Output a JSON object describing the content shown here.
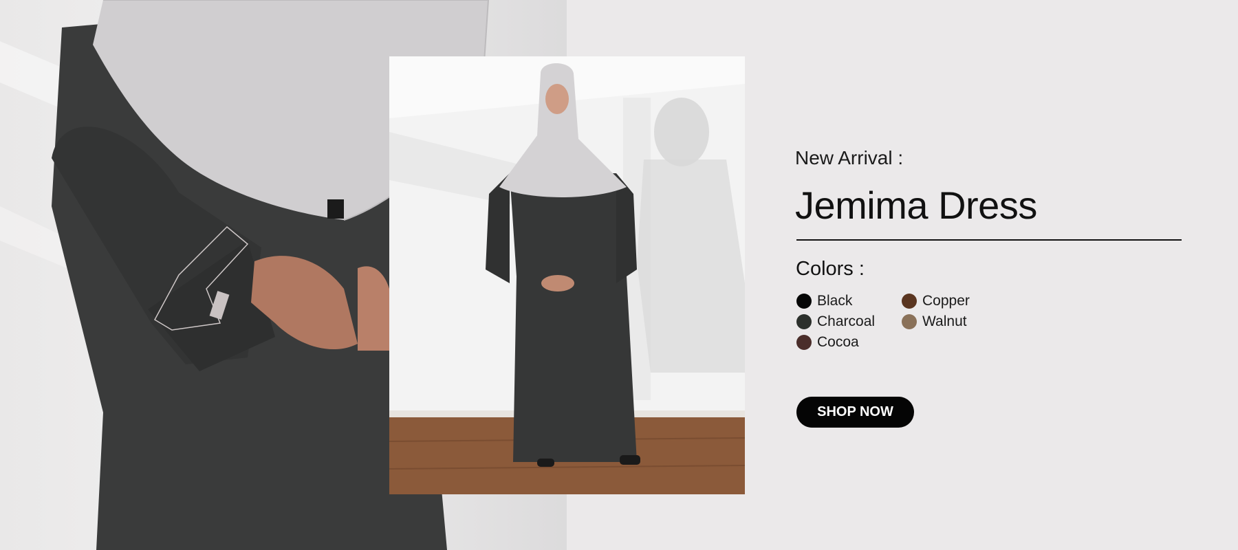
{
  "banner": {
    "subtitle": "New Arrival :",
    "title": "Jemima Dress",
    "colors_heading": "Colors :",
    "colors": [
      {
        "name": "Black",
        "hex": "#060606"
      },
      {
        "name": "Copper",
        "hex": "#5a3520"
      },
      {
        "name": "Charcoal",
        "hex": "#2c302c"
      },
      {
        "name": "Walnut",
        "hex": "#8a7159"
      },
      {
        "name": "Cocoa",
        "hex": "#4a2d2a"
      }
    ],
    "cta_label": "SHOP NOW"
  },
  "images": {
    "closeup_alt": "close-up-photo",
    "full_alt": "full-length-photo"
  },
  "palette": {
    "background": "#ebe9ea",
    "garment": "#3b3c3c",
    "hijab": "#d3d1d3",
    "floor": "#8b5a3a"
  }
}
